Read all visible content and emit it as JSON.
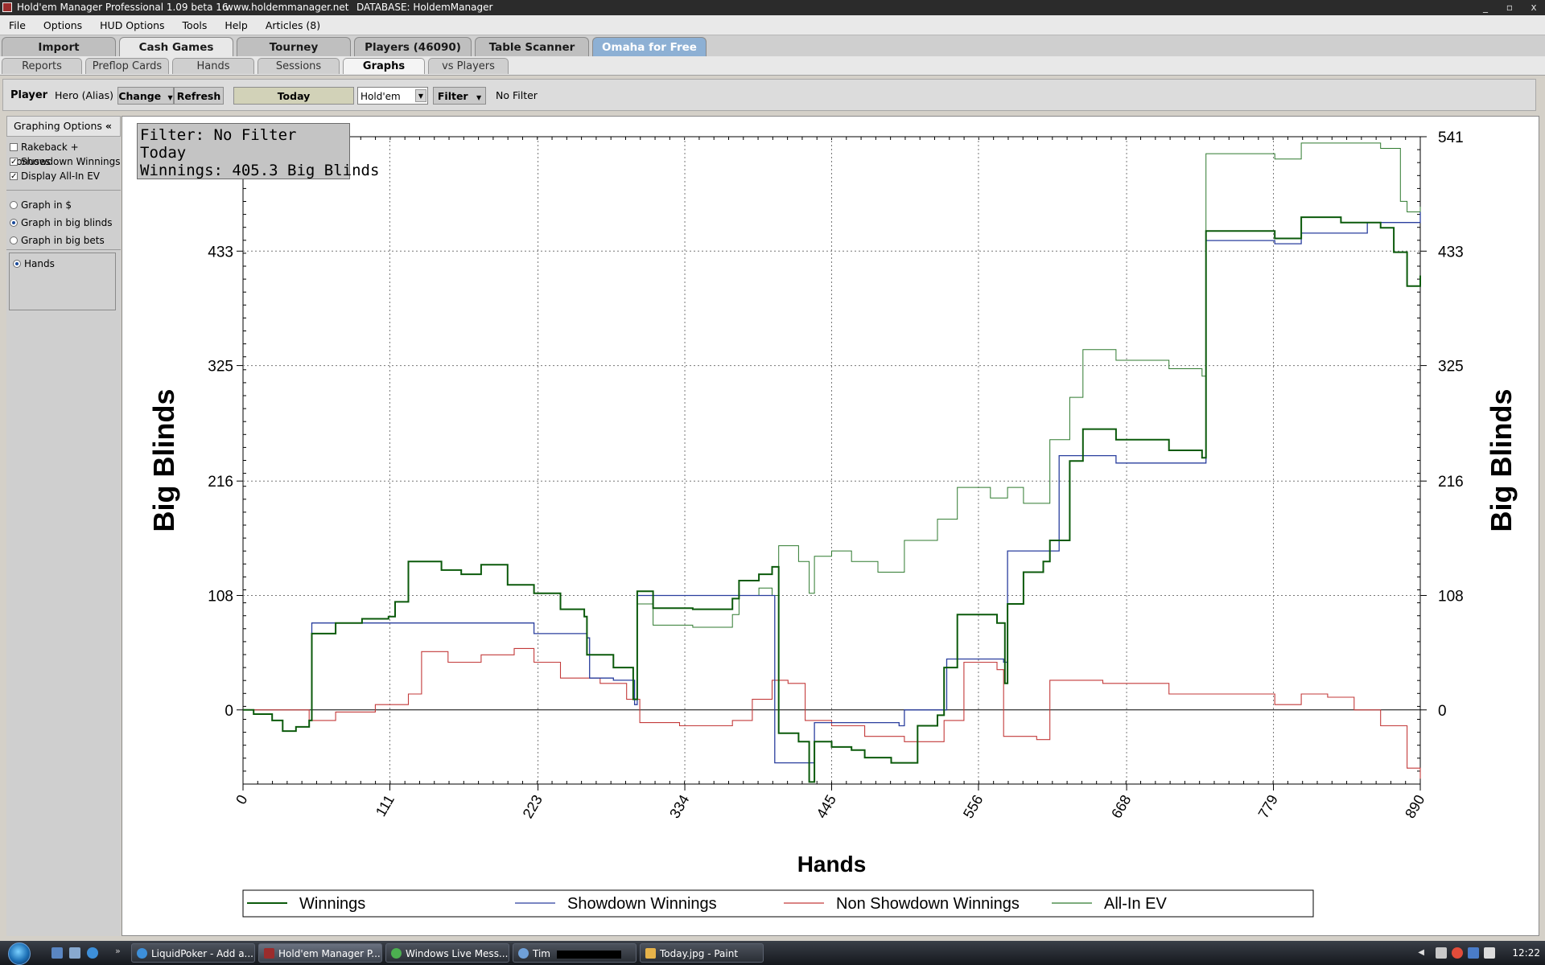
{
  "window": {
    "title": "Hold'em Manager Professional 1.09 beta 16",
    "site": "www.holdemmanager.net",
    "database": "DATABASE: HoldemManager",
    "controls": [
      "_",
      "▫",
      "x"
    ]
  },
  "menu": [
    "File",
    "Options",
    "HUD Options",
    "Tools",
    "Help",
    "Articles (8)"
  ],
  "main_tabs": [
    "Import",
    "Cash Games",
    "Tourney",
    "Players (46090)",
    "Table Scanner",
    "Omaha for Free"
  ],
  "sub_tabs": [
    "Reports",
    "Preflop Cards",
    "Hands",
    "Sessions",
    "Graphs",
    "vs Players"
  ],
  "toolbar": {
    "player_label": "Player",
    "player_name": "Hero (Alias)",
    "change": "Change",
    "refresh": "Refresh",
    "date": "Today",
    "game": "Hold'em",
    "filter": "Filter",
    "filter_status": "No Filter"
  },
  "sidebar": {
    "title": "Graphing Options",
    "collapse": "«",
    "checkboxes": [
      {
        "label": "Rakeback + Bonuses",
        "checked": false
      },
      {
        "label": "Showdown Winnings",
        "checked": true
      },
      {
        "label": "Display All-In EV",
        "checked": true
      }
    ],
    "units": [
      {
        "label": "Graph in $",
        "selected": false
      },
      {
        "label": "Graph in big blinds",
        "selected": true
      },
      {
        "label": "Graph in big bets",
        "selected": false
      }
    ],
    "xaxis": [
      {
        "label": "Hands",
        "selected": true
      }
    ]
  },
  "infobox": {
    "filter": "Filter: No Filter",
    "period": "Today",
    "winnings": "Winnings: 405.3 Big Blinds"
  },
  "chart_data": {
    "type": "line",
    "xlabel": "Hands",
    "ylabel": "Big Blinds",
    "ylabel_right": "Big Blinds",
    "xlim": [
      0,
      890
    ],
    "ylim": [
      -70,
      541
    ],
    "x_ticks": [
      0,
      111,
      223,
      334,
      445,
      556,
      668,
      779,
      890
    ],
    "y_ticks": [
      0,
      108,
      216,
      325,
      433,
      541
    ],
    "grid": true,
    "legend_position": "bottom",
    "series": [
      {
        "name": "Winnings",
        "color": "#0b5a0b",
        "width": 2,
        "points": [
          [
            0,
            0
          ],
          [
            8,
            -4
          ],
          [
            22,
            -10
          ],
          [
            30,
            -20
          ],
          [
            40,
            -16
          ],
          [
            50,
            -10
          ],
          [
            52,
            72
          ],
          [
            70,
            82
          ],
          [
            90,
            86
          ],
          [
            110,
            88
          ],
          [
            115,
            102
          ],
          [
            125,
            140
          ],
          [
            150,
            132
          ],
          [
            165,
            128
          ],
          [
            180,
            137
          ],
          [
            200,
            118
          ],
          [
            220,
            110
          ],
          [
            240,
            95
          ],
          [
            258,
            88
          ],
          [
            260,
            52
          ],
          [
            280,
            40
          ],
          [
            295,
            10
          ],
          [
            298,
            112
          ],
          [
            310,
            96
          ],
          [
            340,
            95
          ],
          [
            370,
            105
          ],
          [
            375,
            122
          ],
          [
            390,
            128
          ],
          [
            400,
            135
          ],
          [
            405,
            -22
          ],
          [
            420,
            -30
          ],
          [
            428,
            -68
          ],
          [
            432,
            -30
          ],
          [
            445,
            -35
          ],
          [
            460,
            -38
          ],
          [
            470,
            -45
          ],
          [
            490,
            -50
          ],
          [
            510,
            -15
          ],
          [
            525,
            -5
          ],
          [
            530,
            40
          ],
          [
            540,
            90
          ],
          [
            570,
            82
          ],
          [
            576,
            25
          ],
          [
            578,
            100
          ],
          [
            590,
            130
          ],
          [
            605,
            140
          ],
          [
            610,
            160
          ],
          [
            625,
            235
          ],
          [
            635,
            265
          ],
          [
            660,
            255
          ],
          [
            700,
            245
          ],
          [
            725,
            238
          ],
          [
            728,
            452
          ],
          [
            780,
            445
          ],
          [
            800,
            465
          ],
          [
            830,
            460
          ],
          [
            860,
            455
          ],
          [
            870,
            432
          ],
          [
            880,
            400
          ],
          [
            890,
            410
          ]
        ]
      },
      {
        "name": "Showdown Winnings",
        "color": "#2a3f9e",
        "width": 1.3,
        "points": [
          [
            0,
            0
          ],
          [
            8,
            -4
          ],
          [
            22,
            -10
          ],
          [
            30,
            -20
          ],
          [
            40,
            -16
          ],
          [
            50,
            -10
          ],
          [
            52,
            82
          ],
          [
            100,
            82
          ],
          [
            190,
            82
          ],
          [
            220,
            72
          ],
          [
            260,
            68
          ],
          [
            262,
            30
          ],
          [
            280,
            28
          ],
          [
            296,
            5
          ],
          [
            298,
            108
          ],
          [
            360,
            108
          ],
          [
            400,
            108
          ],
          [
            402,
            -50
          ],
          [
            430,
            -50
          ],
          [
            432,
            -12
          ],
          [
            470,
            -12
          ],
          [
            496,
            -15
          ],
          [
            500,
            0
          ],
          [
            530,
            0
          ],
          [
            532,
            48
          ],
          [
            575,
            45
          ],
          [
            578,
            150
          ],
          [
            615,
            150
          ],
          [
            617,
            240
          ],
          [
            640,
            240
          ],
          [
            660,
            233
          ],
          [
            725,
            233
          ],
          [
            728,
            443
          ],
          [
            780,
            440
          ],
          [
            800,
            450
          ],
          [
            830,
            450
          ],
          [
            850,
            460
          ],
          [
            885,
            460
          ],
          [
            890,
            470
          ]
        ]
      },
      {
        "name": "Non Showdown Winnings",
        "color": "#c33a3a",
        "width": 1.1,
        "points": [
          [
            0,
            0
          ],
          [
            50,
            -10
          ],
          [
            70,
            -2
          ],
          [
            100,
            5
          ],
          [
            125,
            15
          ],
          [
            135,
            55
          ],
          [
            155,
            45
          ],
          [
            180,
            52
          ],
          [
            205,
            58
          ],
          [
            220,
            45
          ],
          [
            240,
            30
          ],
          [
            270,
            25
          ],
          [
            290,
            10
          ],
          [
            300,
            -12
          ],
          [
            330,
            -15
          ],
          [
            370,
            -10
          ],
          [
            385,
            10
          ],
          [
            400,
            28
          ],
          [
            412,
            25
          ],
          [
            425,
            -10
          ],
          [
            445,
            -15
          ],
          [
            470,
            -25
          ],
          [
            500,
            -30
          ],
          [
            530,
            -10
          ],
          [
            545,
            45
          ],
          [
            570,
            38
          ],
          [
            575,
            -25
          ],
          [
            600,
            -28
          ],
          [
            610,
            28
          ],
          [
            650,
            25
          ],
          [
            700,
            15
          ],
          [
            780,
            5
          ],
          [
            800,
            15
          ],
          [
            820,
            12
          ],
          [
            840,
            0
          ],
          [
            860,
            -15
          ],
          [
            880,
            -55
          ],
          [
            890,
            -65
          ]
        ]
      },
      {
        "name": "All-In EV",
        "color": "#2f7a2f",
        "width": 1,
        "points": [
          [
            0,
            0
          ],
          [
            8,
            -4
          ],
          [
            22,
            -10
          ],
          [
            30,
            -20
          ],
          [
            40,
            -16
          ],
          [
            50,
            -10
          ],
          [
            52,
            72
          ],
          [
            70,
            82
          ],
          [
            90,
            86
          ],
          [
            110,
            88
          ],
          [
            115,
            102
          ],
          [
            125,
            140
          ],
          [
            150,
            132
          ],
          [
            165,
            128
          ],
          [
            180,
            137
          ],
          [
            200,
            118
          ],
          [
            220,
            110
          ],
          [
            240,
            95
          ],
          [
            258,
            88
          ],
          [
            260,
            52
          ],
          [
            280,
            40
          ],
          [
            295,
            10
          ],
          [
            298,
            100
          ],
          [
            310,
            80
          ],
          [
            340,
            78
          ],
          [
            370,
            90
          ],
          [
            375,
            108
          ],
          [
            390,
            115
          ],
          [
            400,
            108
          ],
          [
            405,
            155
          ],
          [
            420,
            140
          ],
          [
            428,
            110
          ],
          [
            432,
            145
          ],
          [
            445,
            150
          ],
          [
            460,
            140
          ],
          [
            480,
            130
          ],
          [
            500,
            160
          ],
          [
            525,
            180
          ],
          [
            540,
            210
          ],
          [
            565,
            200
          ],
          [
            578,
            210
          ],
          [
            590,
            195
          ],
          [
            610,
            255
          ],
          [
            625,
            295
          ],
          [
            635,
            340
          ],
          [
            660,
            330
          ],
          [
            700,
            322
          ],
          [
            725,
            315
          ],
          [
            728,
            525
          ],
          [
            780,
            520
          ],
          [
            800,
            535
          ],
          [
            830,
            535
          ],
          [
            860,
            530
          ],
          [
            875,
            480
          ],
          [
            880,
            470
          ],
          [
            890,
            475
          ]
        ]
      }
    ]
  },
  "taskbar": {
    "buttons": [
      "LiquidPoker - Add a...",
      "Hold'em Manager P...",
      "Windows Live Mess...",
      "Tim",
      "Today.jpg - Paint"
    ],
    "clock": "12:22"
  }
}
